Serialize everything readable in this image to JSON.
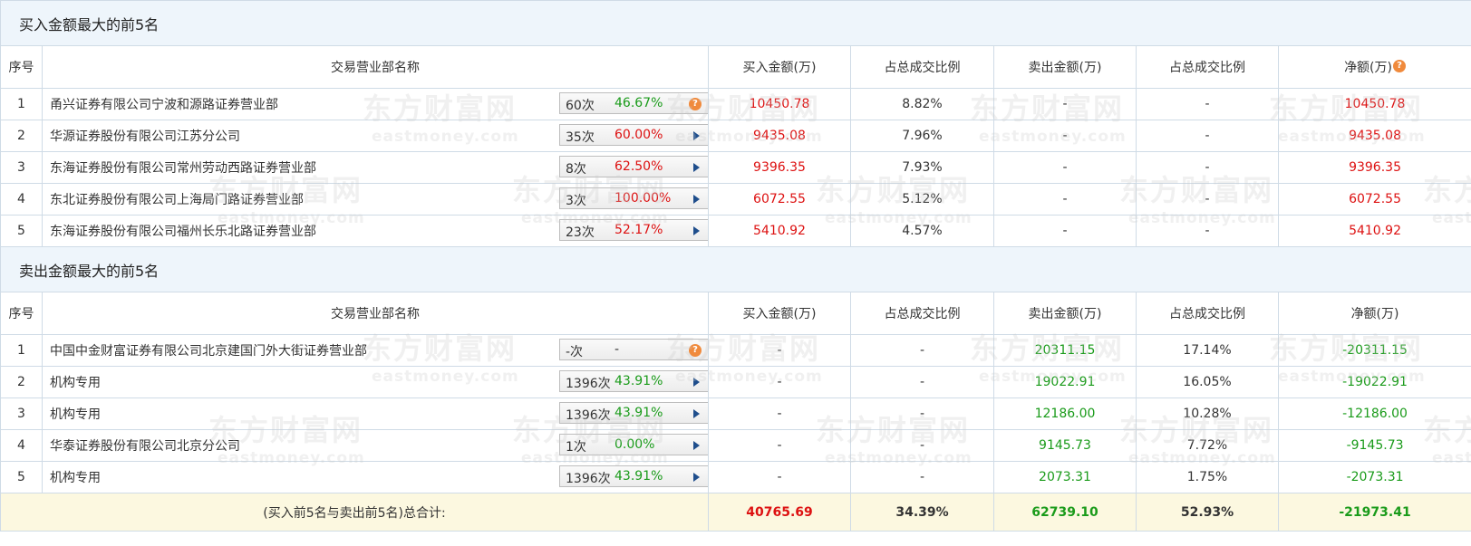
{
  "buy_section": {
    "title": "买入金额最大的前5名",
    "headers": {
      "seq": "序号",
      "name": "交易营业部名称",
      "buy": "买入金额(万)",
      "buy_ratio": "占总成交比例",
      "sell": "卖出金额(万)",
      "sell_ratio": "占总成交比例",
      "net": "净额(万)"
    },
    "rows": [
      {
        "seq": "1",
        "name": "甬兴证券有限公司宁波和源路证券营业部",
        "count": "60次",
        "pct": "46.67%",
        "pct_color": "green",
        "icon": "question-icon",
        "buy": "10450.78",
        "buy_ratio": "8.82%",
        "sell": "-",
        "sell_ratio": "-",
        "net": "10450.78"
      },
      {
        "seq": "2",
        "name": "华源证券股份有限公司江苏分公司",
        "count": "35次",
        "pct": "60.00%",
        "pct_color": "red",
        "icon": "arrow-right-icon",
        "buy": "9435.08",
        "buy_ratio": "7.96%",
        "sell": "-",
        "sell_ratio": "-",
        "net": "9435.08"
      },
      {
        "seq": "3",
        "name": "东海证券股份有限公司常州劳动西路证券营业部",
        "count": "8次",
        "pct": "62.50%",
        "pct_color": "red",
        "icon": "arrow-right-icon",
        "buy": "9396.35",
        "buy_ratio": "7.93%",
        "sell": "-",
        "sell_ratio": "-",
        "net": "9396.35"
      },
      {
        "seq": "4",
        "name": "东北证券股份有限公司上海局门路证券营业部",
        "count": "3次",
        "pct": "100.00%",
        "pct_color": "red",
        "icon": "arrow-right-icon",
        "buy": "6072.55",
        "buy_ratio": "5.12%",
        "sell": "-",
        "sell_ratio": "-",
        "net": "6072.55"
      },
      {
        "seq": "5",
        "name": "东海证券股份有限公司福州长乐北路证券营业部",
        "count": "23次",
        "pct": "52.17%",
        "pct_color": "red",
        "icon": "arrow-right-icon",
        "buy": "5410.92",
        "buy_ratio": "4.57%",
        "sell": "-",
        "sell_ratio": "-",
        "net": "5410.92"
      }
    ]
  },
  "sell_section": {
    "title": "卖出金额最大的前5名",
    "headers": {
      "seq": "序号",
      "name": "交易营业部名称",
      "buy": "买入金额(万)",
      "buy_ratio": "占总成交比例",
      "sell": "卖出金额(万)",
      "sell_ratio": "占总成交比例",
      "net": "净额(万)"
    },
    "rows": [
      {
        "seq": "1",
        "name": "中国中金财富证券有限公司北京建国门外大街证券营业部",
        "count": "-次",
        "pct": "-",
        "pct_color": "gray",
        "icon": "question-icon",
        "buy": "-",
        "buy_ratio": "-",
        "sell": "20311.15",
        "sell_ratio": "17.14%",
        "net": "-20311.15"
      },
      {
        "seq": "2",
        "name": "机构专用",
        "count": "1396次",
        "pct": "43.91%",
        "pct_color": "green",
        "icon": "arrow-right-icon",
        "buy": "-",
        "buy_ratio": "-",
        "sell": "19022.91",
        "sell_ratio": "16.05%",
        "net": "-19022.91"
      },
      {
        "seq": "3",
        "name": "机构专用",
        "count": "1396次",
        "pct": "43.91%",
        "pct_color": "green",
        "icon": "arrow-right-icon",
        "buy": "-",
        "buy_ratio": "-",
        "sell": "12186.00",
        "sell_ratio": "10.28%",
        "net": "-12186.00"
      },
      {
        "seq": "4",
        "name": "华泰证券股份有限公司北京分公司",
        "count": "1次",
        "pct": "0.00%",
        "pct_color": "green",
        "icon": "arrow-right-icon",
        "buy": "-",
        "buy_ratio": "-",
        "sell": "9145.73",
        "sell_ratio": "7.72%",
        "net": "-9145.73"
      },
      {
        "seq": "5",
        "name": "机构专用",
        "count": "1396次",
        "pct": "43.91%",
        "pct_color": "green",
        "icon": "arrow-right-icon",
        "buy": "-",
        "buy_ratio": "-",
        "sell": "2073.31",
        "sell_ratio": "1.75%",
        "net": "-2073.31"
      }
    ]
  },
  "total": {
    "label": "(买入前5名与卖出前5名)总合计:",
    "buy": "40765.69",
    "buy_ratio": "34.39%",
    "sell": "62739.10",
    "sell_ratio": "52.93%",
    "net": "-21973.41"
  },
  "watermark": {
    "cn": "东方财富网",
    "en": "eastmoney.com"
  },
  "colors": {
    "positive": "#d11111",
    "negative": "#1a9b1a",
    "section_bg": "#eef5fb",
    "total_bg": "#fcf8e0",
    "border": "#cfdbe6"
  }
}
